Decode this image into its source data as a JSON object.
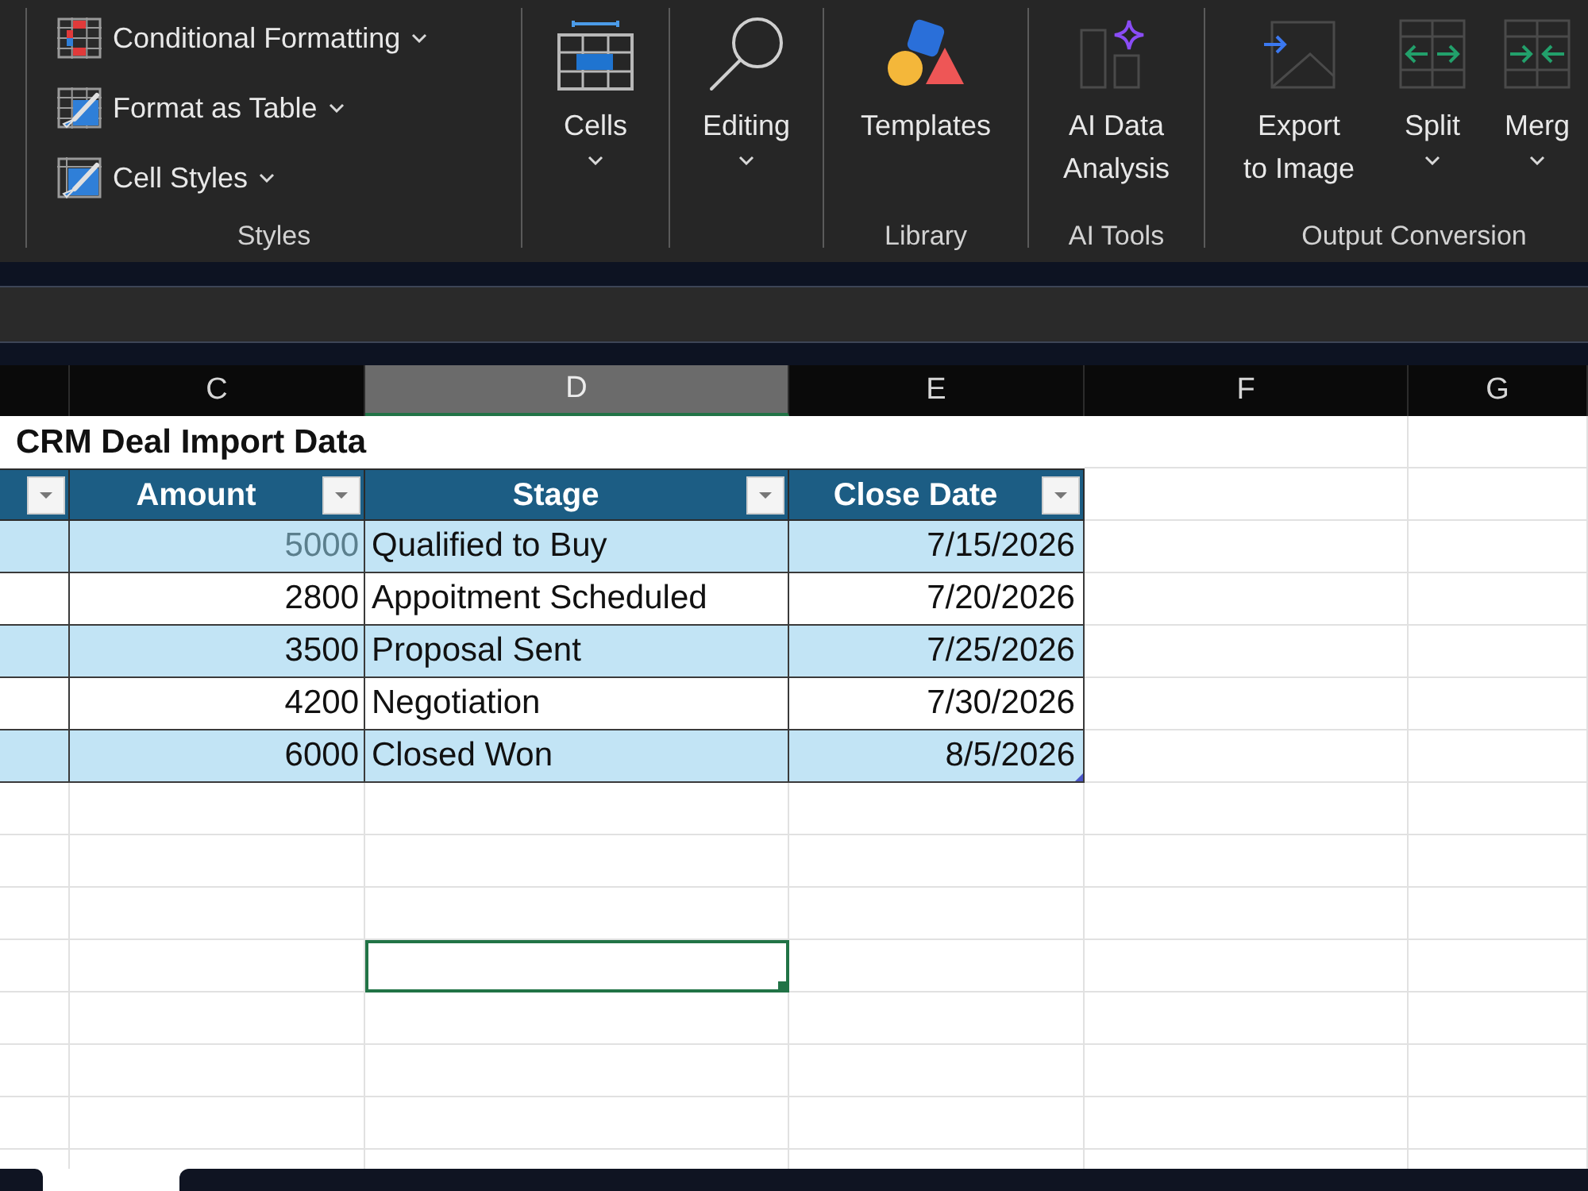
{
  "ribbon": {
    "groups": [
      {
        "label": "Styles",
        "items": [
          {
            "label": "Conditional Formatting",
            "kind": "row",
            "dropdown": true
          },
          {
            "label": "Format as Table",
            "kind": "row",
            "dropdown": true
          },
          {
            "label": "Cell Styles",
            "kind": "row",
            "dropdown": true
          }
        ]
      },
      {
        "items": [
          {
            "label": "Cells",
            "kind": "large",
            "dropdown": true
          }
        ]
      },
      {
        "items": [
          {
            "label": "Editing",
            "kind": "large",
            "dropdown": true
          }
        ]
      },
      {
        "label": "Library",
        "items": [
          {
            "label": "Templates",
            "kind": "large",
            "dropdown": false
          }
        ]
      },
      {
        "label": "AI Tools",
        "items": [
          {
            "label": "AI Data\nAnalysis",
            "kind": "large",
            "dropdown": false
          }
        ]
      },
      {
        "label": "Output Conversion",
        "items": [
          {
            "label": "Export\nto Image",
            "kind": "large",
            "dropdown": false
          },
          {
            "label": "Split",
            "kind": "large",
            "dropdown": true
          },
          {
            "label": "Merg",
            "kind": "large",
            "dropdown": true
          }
        ]
      }
    ]
  },
  "columns": [
    {
      "label": "C",
      "selected": false
    },
    {
      "label": "D",
      "selected": true
    },
    {
      "label": "E",
      "selected": false
    },
    {
      "label": "F",
      "selected": false
    },
    {
      "label": "G",
      "selected": false
    }
  ],
  "sheet": {
    "title": "CRM Deal Import Data",
    "table": {
      "header": [
        {
          "filter_button": true
        },
        {
          "label": "Amount",
          "filter_button": true
        },
        {
          "label": "Stage",
          "filter_button": true
        },
        {
          "label": "Close Date",
          "filter_button": true
        }
      ],
      "rows": [
        {
          "amount": "5000",
          "amount_greyed": true,
          "stage": "Qualified to Buy",
          "close_date": "7/15/2026"
        },
        {
          "amount": "2800",
          "amount_greyed": false,
          "stage": "Appoitment Scheduled",
          "close_date": "7/20/2026"
        },
        {
          "amount": "3500",
          "amount_greyed": false,
          "stage": "Proposal Sent",
          "close_date": "7/25/2026"
        },
        {
          "amount": "4200",
          "amount_greyed": false,
          "stage": "Negotiation",
          "close_date": "7/30/2026"
        },
        {
          "amount": "6000",
          "amount_greyed": false,
          "stage": "Closed Won",
          "close_date": "8/5/2026"
        }
      ]
    },
    "empty_rows": [
      {
        "selected": false
      },
      {
        "selected": false
      },
      {
        "selected": false
      },
      {
        "selected": true
      },
      {
        "selected": false
      },
      {
        "selected": false
      },
      {
        "selected": false
      },
      {
        "selected": false
      }
    ]
  }
}
